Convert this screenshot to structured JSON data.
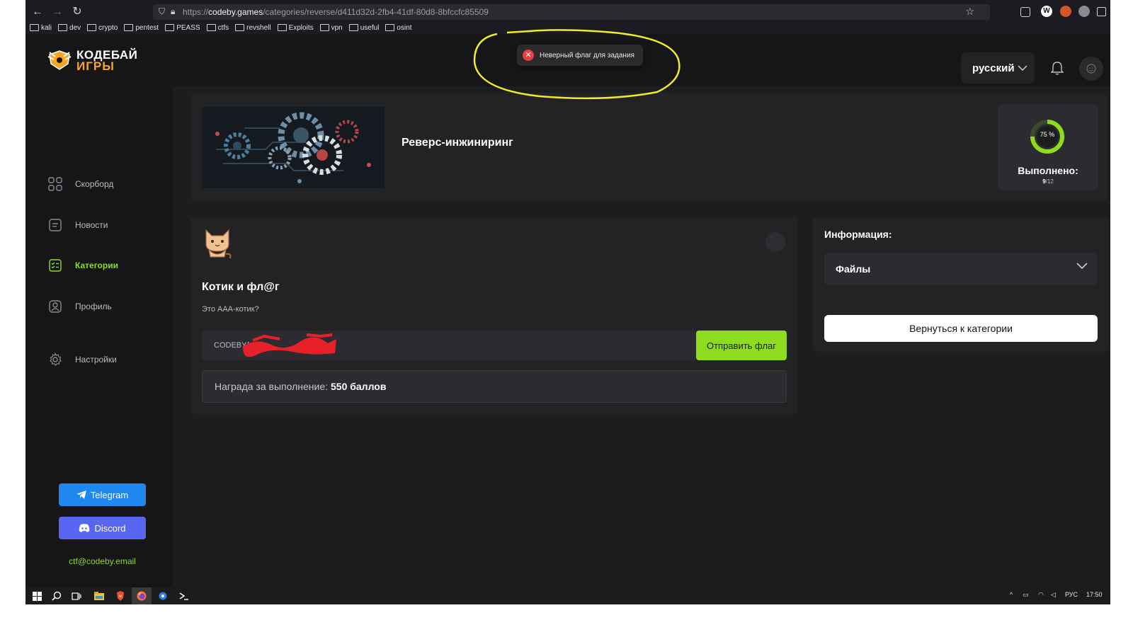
{
  "browser": {
    "url_prefix": "https://",
    "url_domain": "codeby.games",
    "url_path": "/categories/reverse/d411d32d-2fb4-41df-80d8-8bfccfc85509",
    "bookmarks": [
      "kali",
      "dev",
      "crypto",
      "pentest",
      "PEASS",
      "ctfs",
      "revshell",
      "Exploits",
      "vpn",
      "useful",
      "osint"
    ]
  },
  "brand": {
    "line1": "КОДЕБАЙ",
    "line2": "ИГРЫ",
    "accent": "#8fdc1f",
    "orange": "#f6a623"
  },
  "sidebar": {
    "items": [
      {
        "label": "Скорборд",
        "icon": "grid-icon"
      },
      {
        "label": "Новости",
        "icon": "news-icon"
      },
      {
        "label": "Категории",
        "icon": "categories-icon",
        "active": true
      },
      {
        "label": "Профиль",
        "icon": "profile-icon"
      },
      {
        "label": "Настройки",
        "icon": "settings-gear-icon"
      }
    ],
    "telegram_label": "Telegram",
    "discord_label": "Discord",
    "email": "ctf@codeby.email"
  },
  "header": {
    "language": "русский"
  },
  "toast": {
    "message": "Неверный флаг для задания",
    "status_color": "#e8403f"
  },
  "category": {
    "title": "Реверс-инжиниринг",
    "progress_percent": 75,
    "progress_label": "75 %",
    "completed_label": "Выполнено:",
    "completed": "9",
    "total": "/12"
  },
  "task": {
    "title": "Котик и фл@г",
    "description": "Это ААА-котик?",
    "flag_value": "CODEBY{",
    "submit_label": "Отправить флаг",
    "reward_label": "Награда за выполнение:",
    "reward_value": "550 баллов"
  },
  "info": {
    "title": "Информация:",
    "files_label": "Файлы",
    "back_label": "Вернуться к категории"
  },
  "taskbar": {
    "lang": "РУС",
    "time": "17:50"
  }
}
